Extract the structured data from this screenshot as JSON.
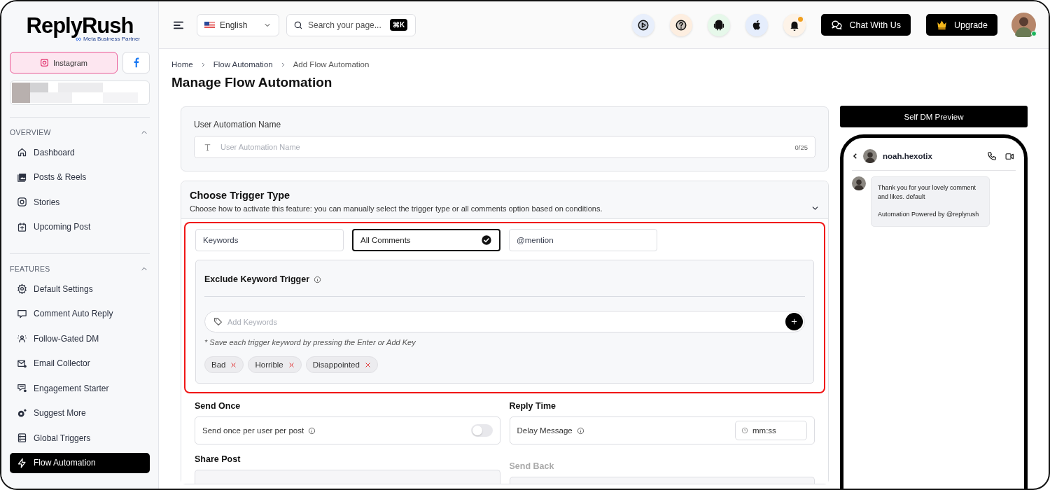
{
  "sidebar": {
    "logo": "ReplyRush",
    "logo_badge": "Meta Business Partner",
    "platforms": [
      {
        "kind": "instagram",
        "label": "Instagram",
        "selected": true
      },
      {
        "kind": "facebook",
        "selected": false
      }
    ],
    "sections": [
      {
        "title": "OVERVIEW",
        "expanded": true,
        "items": [
          {
            "label": "Dashboard",
            "selected": false
          },
          {
            "label": "Posts & Reels",
            "selected": false
          },
          {
            "label": "Stories",
            "selected": false
          },
          {
            "label": "Upcoming Post",
            "selected": false
          }
        ]
      },
      {
        "title": "FEATURES",
        "expanded": true,
        "items": [
          {
            "label": "Default Settings",
            "selected": false
          },
          {
            "label": "Comment Auto Reply",
            "selected": false
          },
          {
            "label": "Follow-Gated DM",
            "selected": false
          },
          {
            "label": "Email Collector",
            "selected": false
          },
          {
            "label": "Engagement Starter",
            "selected": false
          },
          {
            "label": "Suggest More",
            "selected": false
          },
          {
            "label": "Global Triggers",
            "selected": false
          },
          {
            "label": "Flow Automation",
            "selected": true
          }
        ]
      }
    ]
  },
  "header": {
    "language": "English",
    "search": {
      "placeholder": "Search your page...",
      "shortcut": "⌘K"
    },
    "notifications": {
      "unread": true
    },
    "buttons": [
      "Chat With Us",
      "Upgrade"
    ],
    "avatar": {
      "online": true
    }
  },
  "breadcrumbs": [
    "Home",
    "Flow Automation",
    "Add Flow Automation"
  ],
  "page_title": "Manage Flow Automation",
  "name_card": {
    "label": "User Automation Name",
    "placeholder": "User Automation Name",
    "counter": "0/25"
  },
  "trigger": {
    "title": "Choose Trigger Type",
    "description": "Choose how to activate this feature: you can manually select the trigger type or all comments option based on conditions.",
    "expanded": true,
    "highlighted": true,
    "options": [
      {
        "label": "Keywords",
        "selected": false
      },
      {
        "label": "All Comments",
        "selected": true
      },
      {
        "label": "@mention",
        "selected": false
      }
    ],
    "exclude": {
      "title": "Exclude Keyword Trigger",
      "placeholder": "Add Keywords",
      "hint": "* Save each trigger keyword by pressing the Enter or Add Key",
      "tags": [
        "Bad",
        "Horrible",
        "Disappointed"
      ]
    }
  },
  "send_once": {
    "title": "Send Once",
    "label": "Send once per user per post",
    "on": false
  },
  "reply_time": {
    "title": "Reply Time",
    "label": "Delay Message",
    "placeholder": "mm:ss"
  },
  "share_post": {
    "title": "Share Post"
  },
  "send_back": {
    "title": "Send Back",
    "disabled": true
  },
  "preview": {
    "button": "Self DM Preview",
    "username": "noah.hexotix",
    "message": [
      "Thank you for your lovely comment and likes. default",
      "Automation Powered by @replyrush"
    ]
  }
}
